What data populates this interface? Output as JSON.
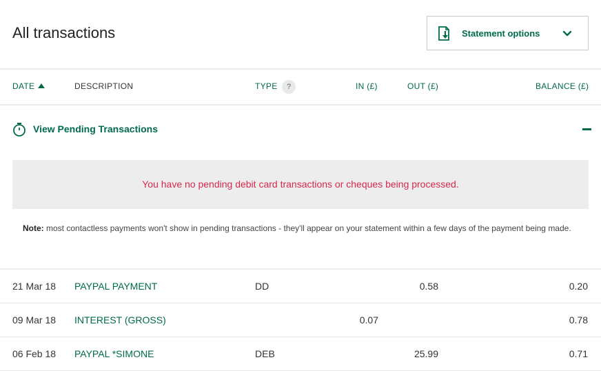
{
  "page": {
    "title": "All transactions"
  },
  "statement_options": {
    "label": "Statement options",
    "icon": "document-download-icon",
    "chevron": "chevron-down-icon"
  },
  "columns": {
    "date": "DATE",
    "description": "DESCRIPTION",
    "type": "TYPE",
    "type_help": "?",
    "in": "IN (£)",
    "out": "OUT (£)",
    "balance": "BALANCE (£)"
  },
  "pending": {
    "link_label": "View Pending Transactions",
    "icon": "stopwatch-icon",
    "message": "You have no pending debit card transactions or cheques being processed.",
    "note_label": "Note:",
    "note_text": " most contactless payments won't show in pending transactions - they'll appear on your statement within a few days of the payment being made."
  },
  "transactions": [
    {
      "date": "21 Mar 18",
      "description": "PAYPAL PAYMENT",
      "type": "DD",
      "in": "",
      "out": "0.58",
      "balance": "0.20"
    },
    {
      "date": "09 Mar 18",
      "description": "INTEREST (GROSS)",
      "type": "",
      "in": "0.07",
      "out": "",
      "balance": "0.78"
    },
    {
      "date": "06 Feb 18",
      "description": "PAYPAL *SIMONE",
      "type": "DEB",
      "in": "",
      "out": "25.99",
      "balance": "0.71"
    }
  ],
  "colors": {
    "brand_green": "#006a4d",
    "alert_red": "#d6284b",
    "notice_bg": "#ededed"
  }
}
